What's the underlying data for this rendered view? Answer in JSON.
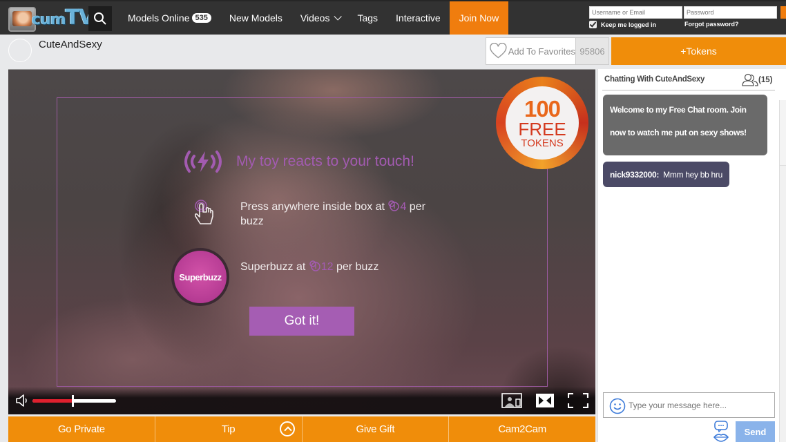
{
  "header": {
    "logo_text": "cumTV",
    "nav": [
      {
        "label": "Models Online",
        "badge": "535"
      },
      {
        "label": "New Models"
      },
      {
        "label": "Videos",
        "has_dropdown": true
      },
      {
        "label": "Tags"
      },
      {
        "label": "Interactive"
      },
      {
        "label": "Join Now",
        "highlight": true
      }
    ],
    "login": {
      "username_placeholder": "Username or Email",
      "password_placeholder": "Password",
      "keep_logged_in_label": "Keep me logged in",
      "keep_logged_in_checked": true,
      "forgot_password_label": "Forgot password?"
    }
  },
  "model": {
    "name": "CuteAndSexy",
    "add_favorites_label": "Add To Favorites",
    "favorites_count": "95806",
    "tokens_button_label": "+Tokens"
  },
  "video": {
    "promo": {
      "amount": "100",
      "line1": "FREE",
      "line2": "TOKENS"
    },
    "overlay": {
      "title": "My toy reacts to your touch!",
      "press_text_before": "Press anywhere inside box at ",
      "press_cost": "4",
      "press_text_after": " per buzz",
      "superbuzz_label": "Superbuzz",
      "superbuzz_text_before": "Superbuzz at ",
      "superbuzz_cost": "12",
      "superbuzz_text_after": " per buzz",
      "got_it_label": "Got it!"
    },
    "volume_percent": 48
  },
  "actions": [
    {
      "label": "Go Private"
    },
    {
      "label": "Tip",
      "has_expand": true
    },
    {
      "label": "Give Gift"
    },
    {
      "label": "Cam2Cam"
    }
  ],
  "chat": {
    "header": "Chatting With CuteAndSexy",
    "user_count": "(15)",
    "messages": [
      {
        "type": "welcome",
        "text": "Welcome to my Free Chat room. Join now to watch me put on sexy shows!"
      },
      {
        "type": "user",
        "user": "nick9332000:",
        "text": "Mmm hey bb hru"
      }
    ],
    "input_placeholder": "Type your message here...",
    "send_label": "Send"
  },
  "colors": {
    "accent_orange": "#f08d0a",
    "join_orange": "#f07d0e",
    "toy_purple": "#a35bb1",
    "nav_bg": "#323232",
    "send_blue": "#8ab3ea"
  }
}
